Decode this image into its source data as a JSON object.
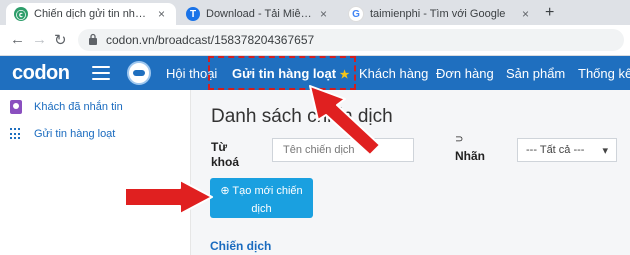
{
  "browser": {
    "tabs": [
      {
        "title": "Chiến dịch gửi tin nhắn diện rộng",
        "favicon": "codon-favicon-icon",
        "active": true
      },
      {
        "title": "Download - Tải Miễn Phí VN - Ph",
        "favicon": "t-favicon-icon",
        "active": false
      },
      {
        "title": "taimienphi - Tìm với Google",
        "favicon": "google-favicon-icon",
        "active": false
      }
    ],
    "new_tab": "+",
    "close_glyph": "×",
    "url": "codon.vn/broadcast/158378204367657"
  },
  "app": {
    "logo": "codon",
    "menu": [
      {
        "label": "Hội thoại",
        "active": false
      },
      {
        "label": "Gửi tin hàng loạt",
        "active": true
      },
      {
        "label": "Khách hàng",
        "active": false
      },
      {
        "label": "Đơn hàng",
        "active": false
      },
      {
        "label": "Sản phẩm",
        "active": false
      },
      {
        "label": "Thống kê",
        "active": false
      }
    ],
    "star": "★"
  },
  "sidebar": {
    "items": [
      {
        "label": "Khách đã nhắn tin",
        "icon": "user-card-icon"
      },
      {
        "label": "Gửi tin hàng loạt",
        "icon": "grid-dots-icon"
      }
    ]
  },
  "main": {
    "title": "Danh sách chiến dịch",
    "keyword_label_1": "Từ",
    "keyword_label_2": "khoá",
    "keyword_placeholder": "Tên chiến dịch",
    "tag_label": "Nhãn",
    "tag_value": "--- Tất cả ---",
    "create_button_line1": "⊕ Tạo mới chiến",
    "create_button_line2": "dịch",
    "section_title": "Chiến dịch"
  },
  "colors": {
    "nav": "#1f6fbf",
    "button": "#1aa0e0",
    "annotation": "#d21f1f"
  }
}
